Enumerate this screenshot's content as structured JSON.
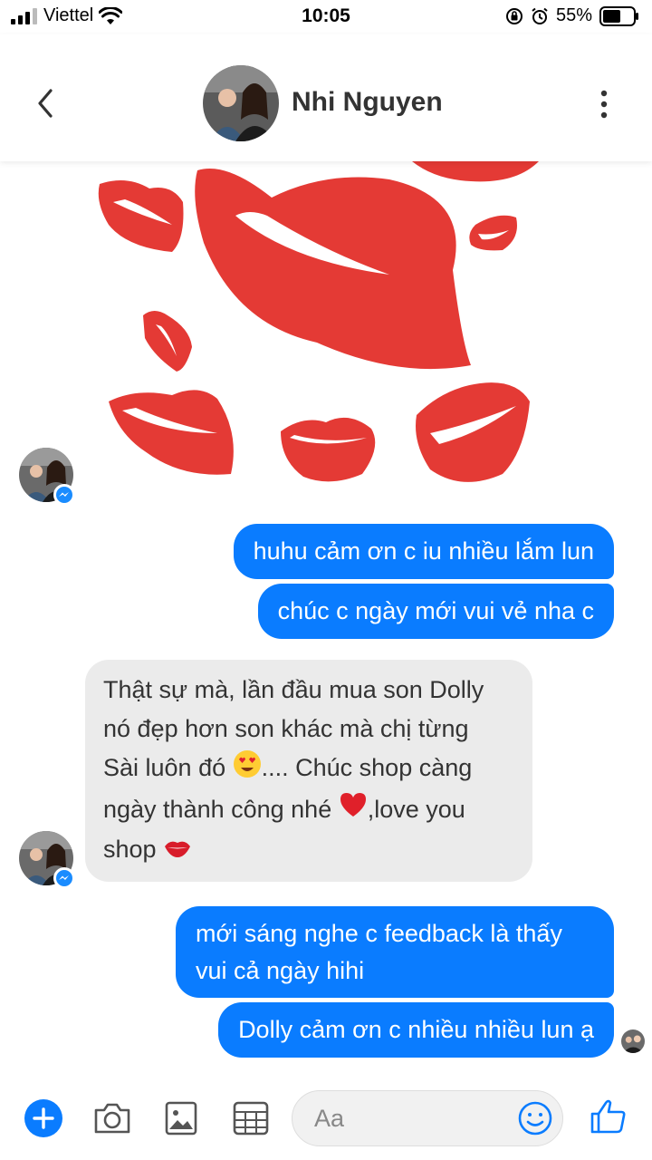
{
  "status_bar": {
    "carrier": "Viettel",
    "time": "10:05",
    "battery": "55%"
  },
  "header": {
    "contact_name": "Nhi Nguyen"
  },
  "messages": [
    {
      "type": "sticker",
      "icon": "lips-sticker",
      "direction": "incoming"
    },
    {
      "direction": "outgoing",
      "text": "huhu cảm ơn c iu nhiều lắm lun"
    },
    {
      "direction": "outgoing",
      "text": "chúc c ngày mới vui vẻ nha c"
    },
    {
      "direction": "incoming",
      "lines": [
        "Thật sự mà, lần đầu mua son Dolly",
        "nó đẹp hơn son khác mà chị từng",
        "Sài luôn đó",
        ".... Chúc shop càng",
        "ngày thành công nhé",
        ",love you",
        "shop"
      ]
    },
    {
      "direction": "outgoing",
      "lines": [
        "mới sáng nghe c feedback là thấy",
        "vui cả ngày hihi"
      ]
    },
    {
      "direction": "outgoing",
      "text": "Dolly cảm ơn c nhiều nhiều lun ạ"
    }
  ],
  "composer": {
    "placeholder": "Aa"
  },
  "colors": {
    "accent": "#0a7cff",
    "incoming_bubble": "#ebebeb",
    "sticker_red": "#e43a35"
  }
}
